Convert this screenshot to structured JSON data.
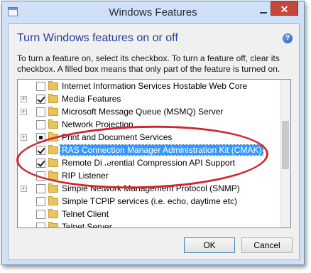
{
  "window": {
    "title": "Windows Features",
    "close_glyph": "✕",
    "icons": {
      "app": "windows-features-icon",
      "minimize": "minimize-icon",
      "close": "close-icon"
    }
  },
  "dialog": {
    "heading": "Turn Windows features on or off",
    "help_glyph": "?",
    "description": "To turn a feature on, select its checkbox. To turn a feature off, clear its checkbox. A filled box means that only part of the feature is turned on."
  },
  "features": [
    {
      "label": "Internet Information Services Hostable Web Core",
      "state": "unchecked",
      "expandable": false,
      "selected": false
    },
    {
      "label": "Media Features",
      "state": "checked",
      "expandable": true,
      "selected": false
    },
    {
      "label": "Microsoft Message Queue (MSMQ) Server",
      "state": "unchecked",
      "expandable": true,
      "selected": false
    },
    {
      "label": "Network Projection",
      "state": "unchecked",
      "expandable": false,
      "selected": false
    },
    {
      "label": "Print and Document Services",
      "state": "partial",
      "expandable": true,
      "selected": false
    },
    {
      "label": "RAS Connection Manager Administration Kit (CMAK)",
      "state": "checked",
      "expandable": false,
      "selected": true
    },
    {
      "label": "Remote Differential Compression API Support",
      "state": "checked",
      "expandable": false,
      "selected": false
    },
    {
      "label": "RIP Listener",
      "state": "unchecked",
      "expandable": false,
      "selected": false
    },
    {
      "label": "Simple Network Management Protocol (SNMP)",
      "state": "unchecked",
      "expandable": true,
      "selected": false
    },
    {
      "label": "Simple TCPIP services (i.e. echo, daytime etc)",
      "state": "unchecked",
      "expandable": false,
      "selected": false
    },
    {
      "label": "Telnet Client",
      "state": "unchecked",
      "expandable": false,
      "selected": false
    },
    {
      "label": "Telnet Server",
      "state": "unchecked",
      "expandable": false,
      "selected": false
    }
  ],
  "buttons": {
    "ok": "OK",
    "cancel": "Cancel"
  },
  "colors": {
    "selection": "#3399ff",
    "annotation": "#d0272d",
    "heading": "#1f3d9a"
  }
}
